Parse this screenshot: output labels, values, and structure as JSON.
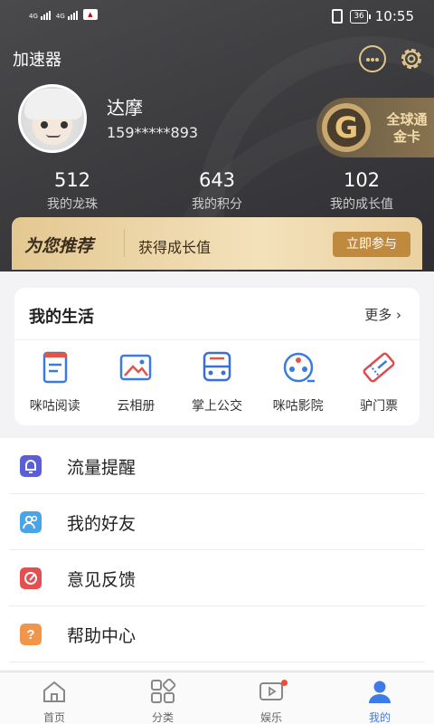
{
  "status_bar": {
    "signal1": "4G",
    "signal2": "4G",
    "battery": "36",
    "time": "10:55"
  },
  "header": {
    "title": "加速器",
    "icons": [
      "message-icon",
      "settings-gear-icon"
    ]
  },
  "profile": {
    "name": "达摩",
    "phone": "159*****893",
    "vip_badge": {
      "logo": "G",
      "line1": "全球通",
      "line2": "金卡"
    }
  },
  "stats": [
    {
      "value": "512",
      "label": "我的龙珠"
    },
    {
      "value": "643",
      "label": "我的积分"
    },
    {
      "value": "102",
      "label": "我的成长值"
    }
  ],
  "recommend": {
    "title": "为您推荐",
    "desc": "获得成长值",
    "button": "立即参与"
  },
  "life": {
    "title": "我的生活",
    "more": "更多",
    "items": [
      {
        "label": "咪咕阅读",
        "icon": "book-icon",
        "color": "#e0574a"
      },
      {
        "label": "云相册",
        "icon": "photo-album-icon",
        "color": "#3a7be0"
      },
      {
        "label": "掌上公交",
        "icon": "bus-icon",
        "color": "#3a6fd8"
      },
      {
        "label": "咪咕影院",
        "icon": "film-reel-icon",
        "color": "#3a7be0"
      },
      {
        "label": "驴门票",
        "icon": "ticket-icon",
        "color": "#e04b4b"
      }
    ]
  },
  "menu": [
    {
      "label": "流量提醒",
      "icon": "bell-icon",
      "color": "#5a5fd8"
    },
    {
      "label": "我的好友",
      "icon": "friends-icon",
      "color": "#4aa5e8"
    },
    {
      "label": "意见反馈",
      "icon": "feedback-icon",
      "color": "#e45050"
    },
    {
      "label": "帮助中心",
      "icon": "question-icon",
      "color": "#f0954a"
    }
  ],
  "bottom_nav": [
    {
      "label": "首页",
      "icon": "home-icon"
    },
    {
      "label": "分类",
      "icon": "category-icon"
    },
    {
      "label": "娱乐",
      "icon": "video-play-icon",
      "badge": true
    },
    {
      "label": "我的",
      "icon": "profile-icon",
      "active": true
    }
  ]
}
